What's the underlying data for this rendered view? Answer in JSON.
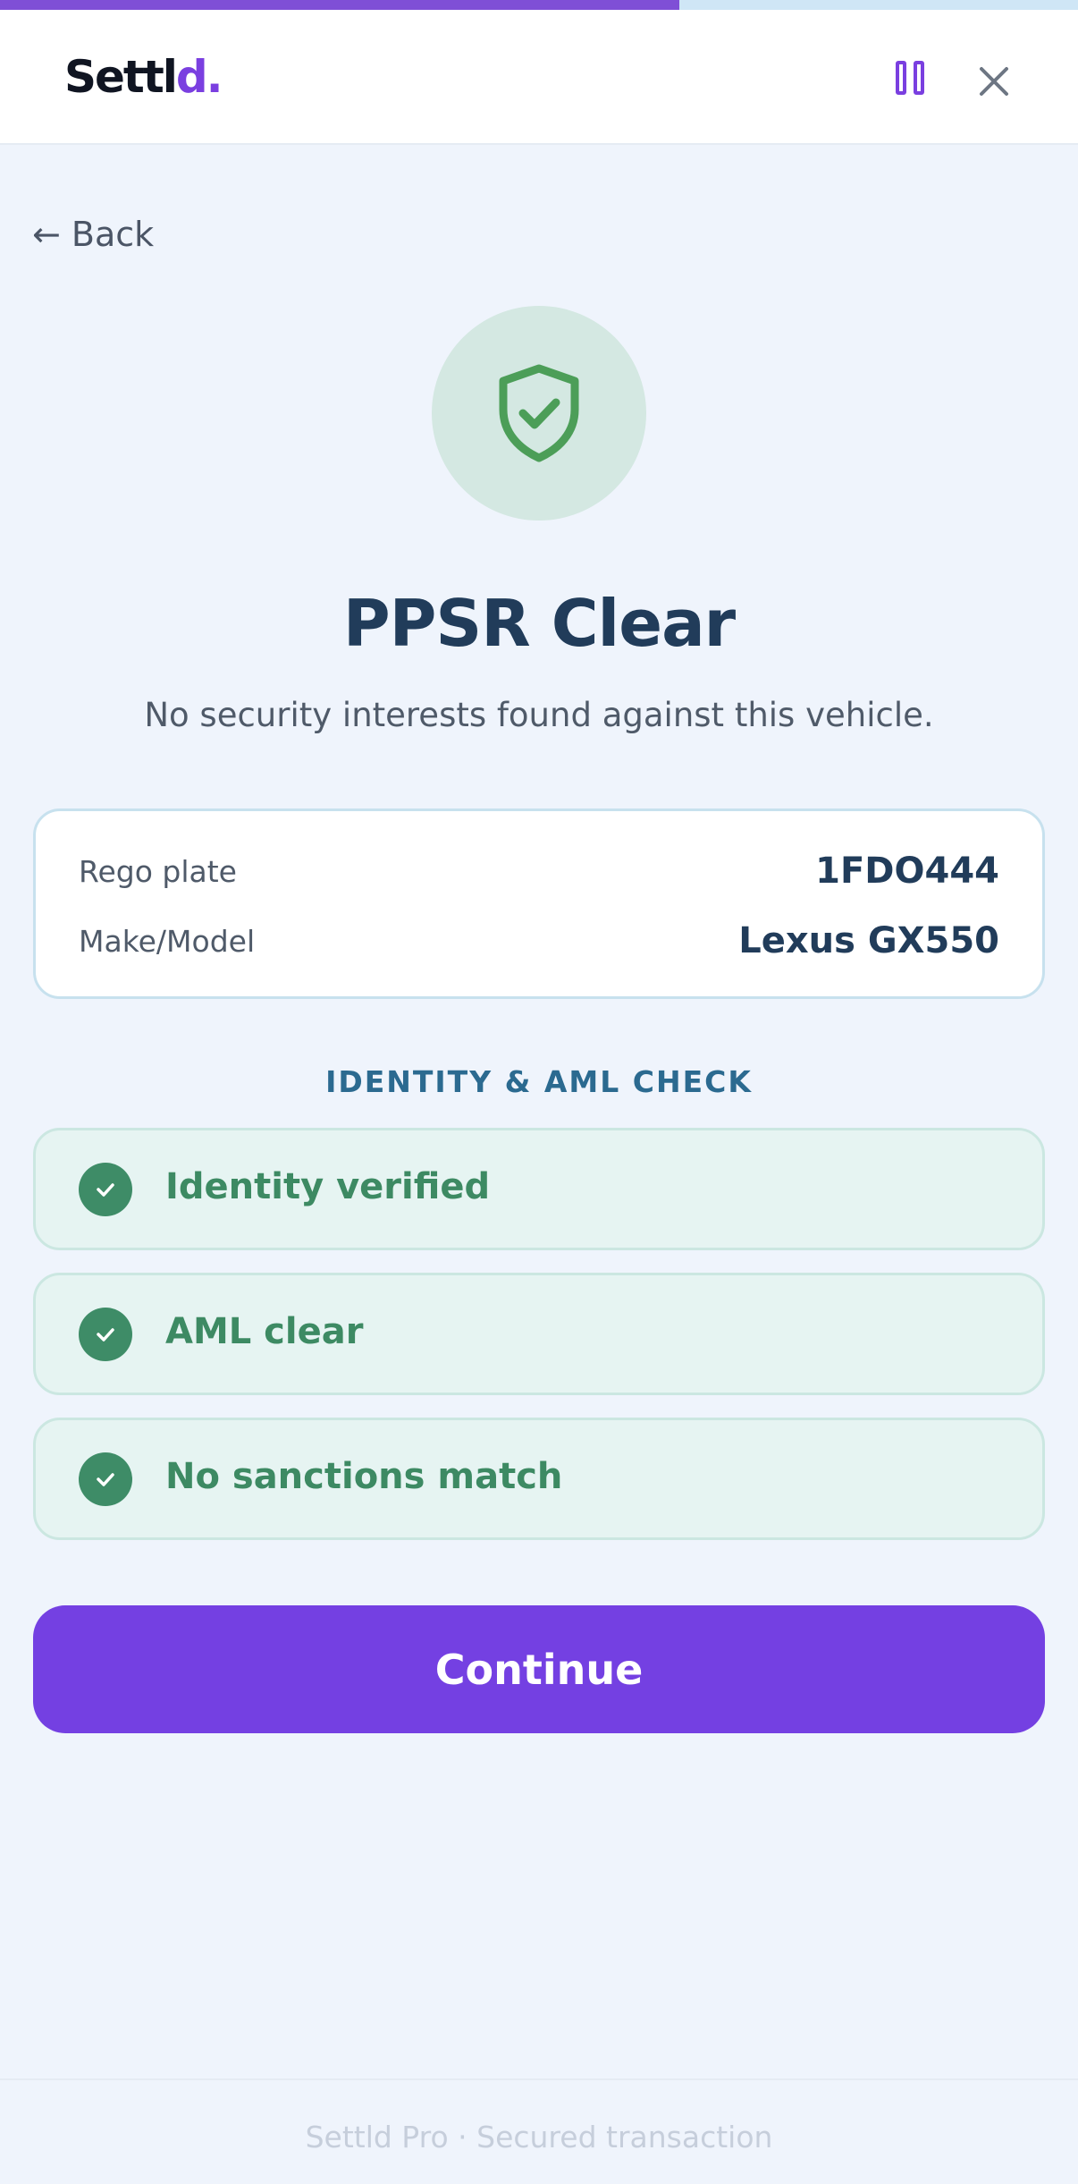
{
  "progress": {
    "fraction": 0.63,
    "fill_color": "#7f4fd6",
    "track_color": "#cfe6f6"
  },
  "header": {
    "logo_main": "Settl",
    "logo_accent": "d.",
    "pause_icon": "pause-icon",
    "close_icon": "close-icon"
  },
  "nav": {
    "back_label": "← Back"
  },
  "status": {
    "icon": "shield-check-icon",
    "title": "PPSR Clear",
    "subtitle": "No security interests found against this vehicle."
  },
  "vehicle": {
    "rows": [
      {
        "label": "Rego plate",
        "value": "1FDO444"
      },
      {
        "label": "Make/Model",
        "value": "Lexus GX550"
      }
    ]
  },
  "checks": {
    "heading": "IDENTITY & AML CHECK",
    "items": [
      {
        "label": "Identity verified",
        "icon": "check-icon"
      },
      {
        "label": "AML clear",
        "icon": "check-icon"
      },
      {
        "label": "No sanctions match",
        "icon": "check-icon"
      }
    ]
  },
  "actions": {
    "continue_label": "Continue"
  },
  "footer": {
    "text": "Settld Pro · Secured transaction"
  },
  "colors": {
    "accent": "#7440e2",
    "success": "#3e8c67",
    "title": "#213c5a",
    "background": "#eff4fc"
  }
}
